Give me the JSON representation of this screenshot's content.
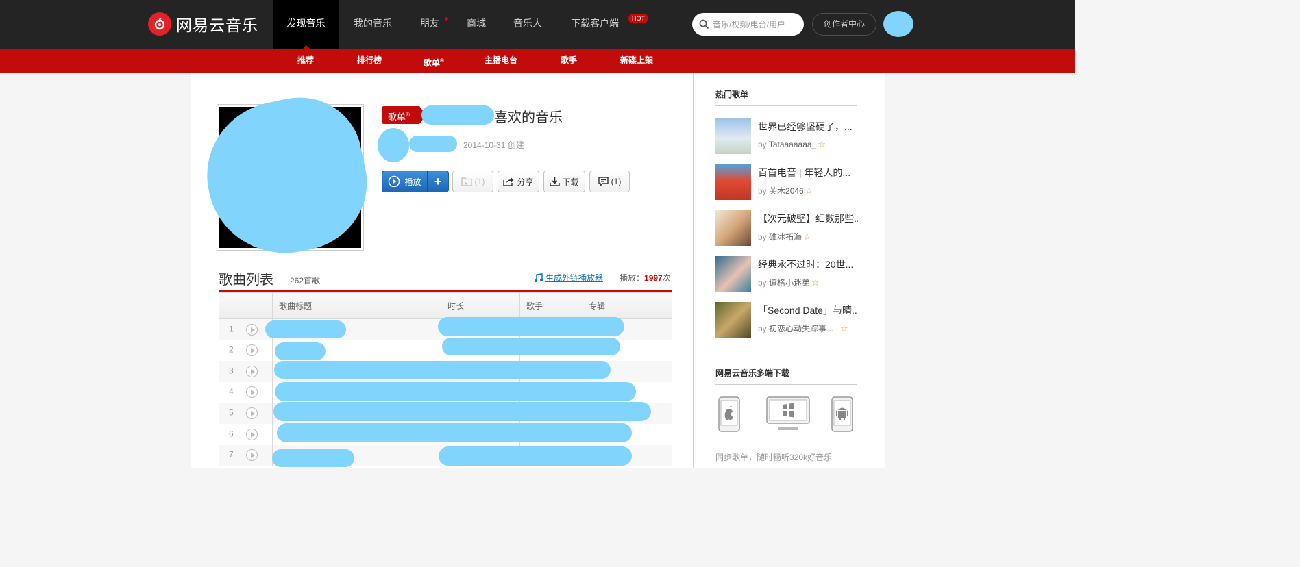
{
  "header": {
    "logo_text": "网易云音乐",
    "nav": [
      {
        "label": "发现音乐"
      },
      {
        "label": "我的音乐"
      },
      {
        "label": "朋友"
      },
      {
        "label": "商城"
      },
      {
        "label": "音乐人"
      },
      {
        "label": "下载客户端"
      }
    ],
    "hot_badge": "HOT",
    "search_placeholder": "音乐/视频/电台/用户",
    "creator_center": "创作者中心"
  },
  "subnav": {
    "items": [
      {
        "label": "推荐"
      },
      {
        "label": "排行榜"
      },
      {
        "label": "歌单",
        "sup": "®"
      },
      {
        "label": "主播电台"
      },
      {
        "label": "歌手"
      },
      {
        "label": "新碟上架"
      }
    ]
  },
  "playlist": {
    "tag": "歌单",
    "tag_sup": "®",
    "title": "喜欢的音乐",
    "created": "2014-10-31 创建",
    "buttons": {
      "play": "播放",
      "add": "+",
      "collect": "(1)",
      "share": "分享",
      "download": "下载",
      "comment": "(1)"
    }
  },
  "songs": {
    "title": "歌曲列表",
    "count": "262首歌",
    "outlink": "生成外链播放器",
    "play_label": "播放：",
    "play_count": "1997",
    "play_unit": "次",
    "columns": [
      "歌曲标题",
      "时长",
      "歌手",
      "专辑"
    ],
    "rows": [
      {
        "index": "1"
      },
      {
        "index": "2"
      },
      {
        "index": "3"
      },
      {
        "index": "4"
      },
      {
        "index": "5"
      },
      {
        "index": "6"
      },
      {
        "index": "7"
      }
    ]
  },
  "sidebar": {
    "hot_title": "热门歌单",
    "hot_lists": [
      {
        "name": "世界已经够坚硬了，...",
        "by": "by",
        "author": "Tataaaaaaa_",
        "thumb_color": "#a9cbe6"
      },
      {
        "name": "百首电音 | 年轻人的...",
        "by": "by",
        "author": "芙木2046",
        "thumb_color": "#d94636"
      },
      {
        "name": "【次元破壁】细数那些...",
        "by": "by",
        "author": "碓冰拓海",
        "thumb_color": "#d8b48a"
      },
      {
        "name": "经典永不过时：20世...",
        "by": "by",
        "author": "道格小迷弟",
        "thumb_color": "#5a8fa7"
      },
      {
        "name": "「Second Date」与晴...",
        "by": "by",
        "author": "初恋心动失踪事...",
        "thumb_color": "#8a7a3e"
      }
    ],
    "download_title": "网易云音乐多端下载",
    "download_text": "同步歌单，随时畅听320k好音乐"
  },
  "colors": {
    "brand_red": "#c20c0c",
    "topbar_bg": "#242424",
    "link_blue": "#0c73c2",
    "redaction": "#81d4fb"
  }
}
